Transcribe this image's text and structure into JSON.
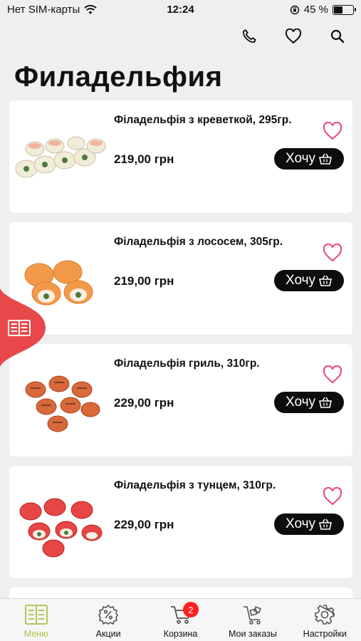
{
  "status_bar": {
    "carrier": "Нет SIM-карты",
    "time": "12:24",
    "battery_percent": "45 %",
    "battery_level": 0.45
  },
  "header": {
    "title": "Филадельфия",
    "actions": [
      "phone-icon",
      "heart-icon",
      "search-icon"
    ]
  },
  "products": [
    {
      "name": "Філадельфія з креветкой, 295гр.",
      "price": "219,00 грн",
      "button_label": "Хочу",
      "color": "#f1ecd8"
    },
    {
      "name": "Філадельфія з лососем, 305гр.",
      "price": "219,00 грн",
      "button_label": "Хочу",
      "color": "#f39a4a"
    },
    {
      "name": "Філадельфія гриль, 310гр.",
      "price": "229,00 грн",
      "button_label": "Хочу",
      "color": "#d9683a"
    },
    {
      "name": "Філадельфія з тунцем, 310гр.",
      "price": "229,00 грн",
      "button_label": "Хочу",
      "color": "#e84545"
    }
  ],
  "side_tab": {
    "icon": "menu-book-icon",
    "color": "#e8484a"
  },
  "tabbar": {
    "tabs": [
      {
        "label": "Меню",
        "icon": "menu-book-icon",
        "active": true
      },
      {
        "label": "Акции",
        "icon": "discount-gear-icon"
      },
      {
        "label": "Корзина",
        "icon": "cart-icon",
        "badge": "2"
      },
      {
        "label": "Мои заказы",
        "icon": "orders-cart-icon"
      },
      {
        "label": "Настройки",
        "icon": "settings-gear-icon"
      }
    ]
  },
  "colors": {
    "accent_green": "#a9c247",
    "favorite_pink": "#e8457a",
    "badge_red": "#ff1f1f",
    "button_black": "#0d0d0d"
  }
}
